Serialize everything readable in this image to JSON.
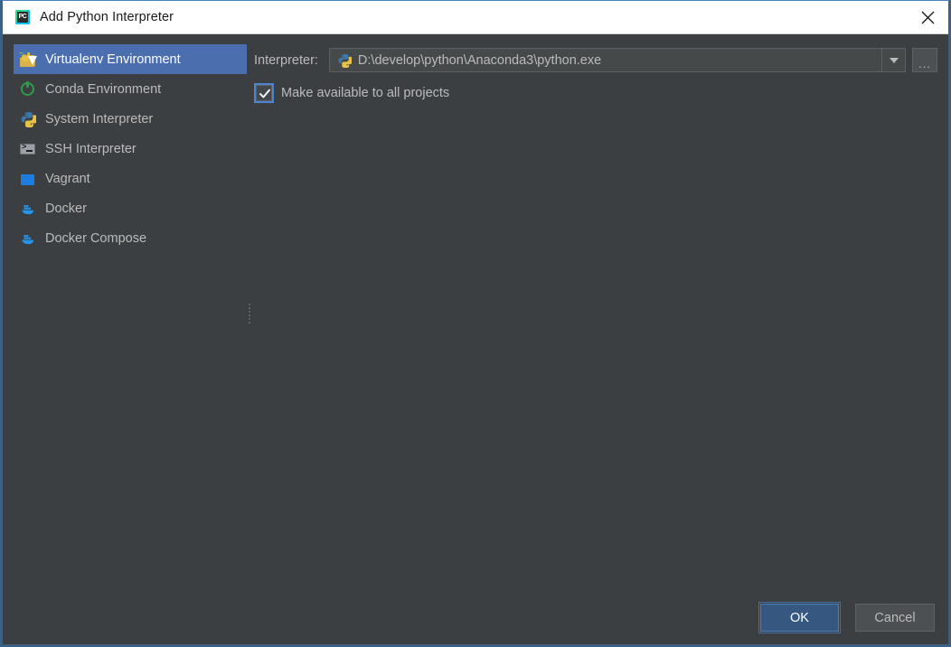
{
  "window": {
    "title": "Add Python Interpreter",
    "app_icon": "pycharm-icon",
    "close_icon": "close-icon",
    "colors": {
      "background": "#3c3f41",
      "selection": "#4b6eaf",
      "accent": "#365880",
      "border": "#3d6185",
      "text": "#bbbbbb",
      "titlebar_bg": "#ffffff",
      "titlebar_text": "#1a1a1a"
    }
  },
  "sidebar": {
    "items": [
      {
        "label": "Virtualenv Environment",
        "icon": "virtualenv-icon",
        "selected": true
      },
      {
        "label": "Conda Environment",
        "icon": "conda-icon",
        "selected": false
      },
      {
        "label": "System Interpreter",
        "icon": "python-icon",
        "selected": false
      },
      {
        "label": "SSH Interpreter",
        "icon": "terminal-icon",
        "selected": false
      },
      {
        "label": "Vagrant",
        "icon": "vagrant-icon",
        "selected": false
      },
      {
        "label": "Docker",
        "icon": "docker-icon",
        "selected": false
      },
      {
        "label": "Docker Compose",
        "icon": "docker-compose-icon",
        "selected": false
      }
    ]
  },
  "main": {
    "interpreter": {
      "label": "Interpreter:",
      "value": "D:\\develop\\python\\Anaconda3\\python.exe",
      "icon": "python-icon",
      "dropdown_icon": "chevron-down-icon",
      "browse_label": "...",
      "browse_icon": "ellipsis-icon"
    },
    "make_available": {
      "label": "Make available to all projects",
      "checked": true
    }
  },
  "footer": {
    "ok_label": "OK",
    "cancel_label": "Cancel"
  }
}
